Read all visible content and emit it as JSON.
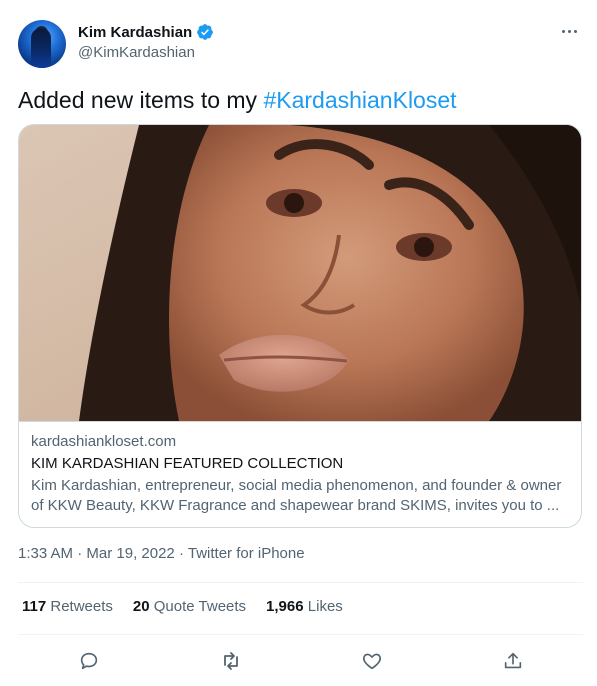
{
  "author": {
    "display_name": "Kim Kardashian",
    "handle": "@KimKardashian",
    "verified": true
  },
  "tweet": {
    "text_prefix": "Added new items to my ",
    "hashtag": "#KardashianKloset"
  },
  "card": {
    "domain": "kardashiankloset.com",
    "title": "KIM KARDASHIAN FEATURED COLLECTION",
    "description_line1": "Kim Kardashian, entrepreneur, social media phenomenon, and founder & owner",
    "description_line2": "of KKW Beauty, KKW Fragrance and shapewear brand SKIMS, invites you to ..."
  },
  "meta": {
    "time": "1:33 AM",
    "date": "Mar 19, 2022",
    "source": "Twitter for iPhone",
    "separator": "·"
  },
  "stats": {
    "retweets_count": "117",
    "retweets_label": "Retweets",
    "quotes_count": "20",
    "quotes_label": "Quote Tweets",
    "likes_count": "1,966",
    "likes_label": "Likes"
  },
  "icons": {
    "reply": "reply-icon",
    "retweet": "retweet-icon",
    "like": "heart-icon",
    "share": "share-icon",
    "more": "more-icon",
    "verified": "verified-badge-icon"
  },
  "colors": {
    "accent": "#1d9bf0",
    "text": "#0f1419",
    "secondary": "#536471",
    "border": "#cfd9de"
  }
}
